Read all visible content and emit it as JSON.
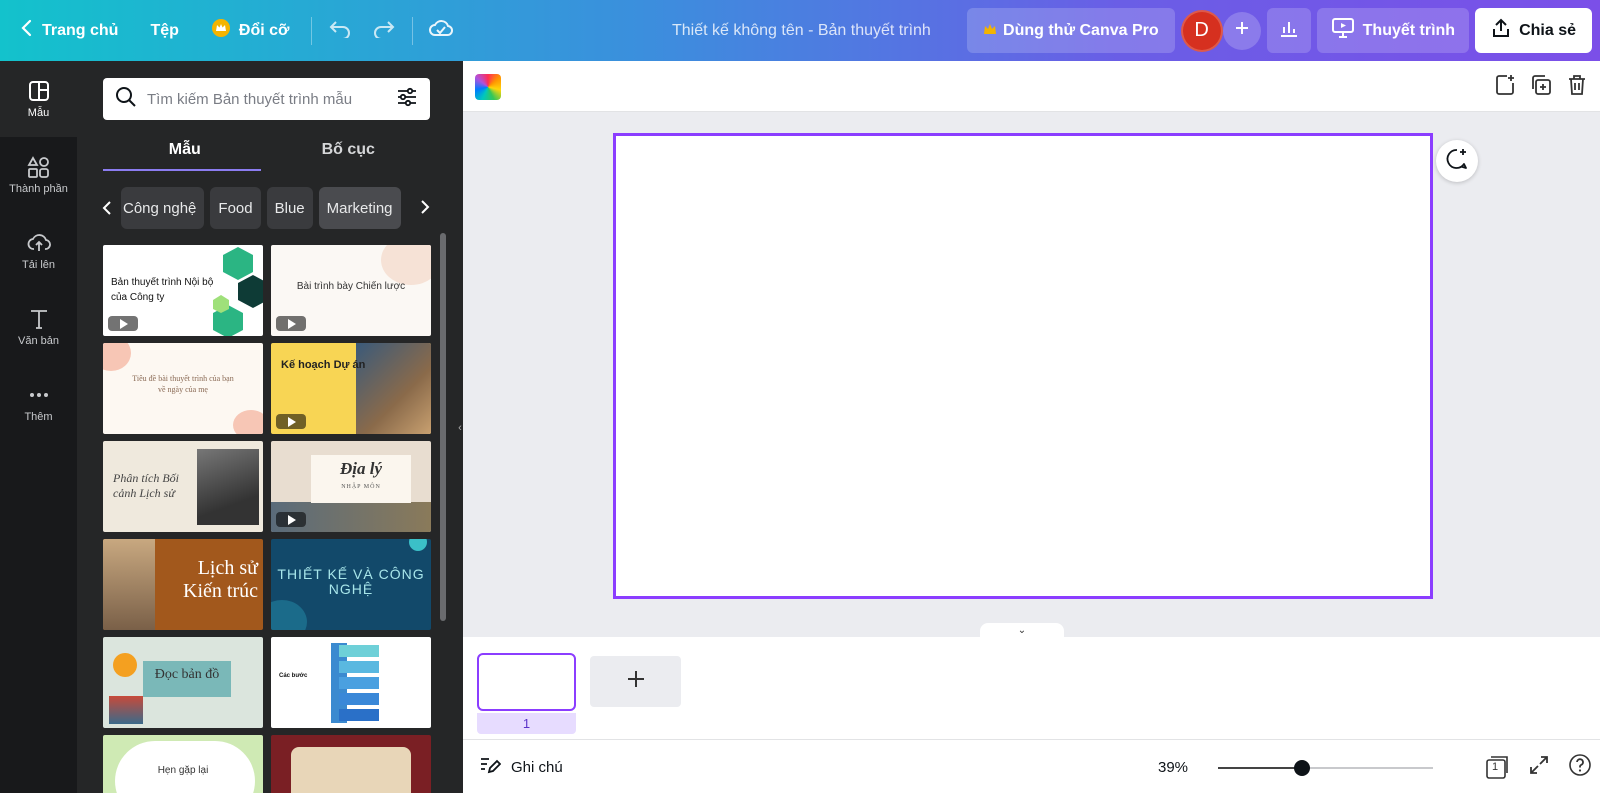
{
  "topbar": {
    "home_label": "Trang chủ",
    "file_label": "Tệp",
    "resize_label": "Đổi cỡ",
    "document_title": "Thiết kế không tên - Bản thuyết trình",
    "pro_label": "Dùng thử Canva Pro",
    "avatar_initial": "D",
    "present_label": "Thuyết trình",
    "share_label": "Chia sẻ"
  },
  "rail": {
    "items": [
      {
        "label": "Mẫu",
        "icon": "template-icon"
      },
      {
        "label": "Thành phần",
        "icon": "elements-icon"
      },
      {
        "label": "Tải lên",
        "icon": "upload-cloud-icon"
      },
      {
        "label": "Văn bản",
        "icon": "text-icon"
      },
      {
        "label": "Thêm",
        "icon": "more-dots-icon"
      }
    ]
  },
  "panel": {
    "search_placeholder": "Tìm kiếm Bản thuyết trình mẫu",
    "tabs": [
      "Mẫu",
      "Bố cục"
    ],
    "chips": [
      "Công nghệ",
      "Food",
      "Blue",
      "Marketing"
    ],
    "templates": [
      {
        "title": "Bản thuyết trình Nội bộ của Công ty",
        "video": true
      },
      {
        "title": "Bài trình bày Chiến lược",
        "video": true
      },
      {
        "title": "Tiêu đề bài thuyết trình của bạn về ngày của mẹ",
        "video": false
      },
      {
        "title": "Kế hoạch Dự án",
        "video": true
      },
      {
        "title": "Phân tích Bối cảnh Lịch sử",
        "video": false
      },
      {
        "title": "Địa lý",
        "subtitle": "NHẬP MÔN",
        "video": true
      },
      {
        "title": "Lịch sử Kiến trúc",
        "video": false
      },
      {
        "title": "THIẾT KẾ VÀ CÔNG NGHỆ",
        "video": false
      },
      {
        "title": "Đọc bản đồ",
        "video": false
      },
      {
        "title": "Các bước",
        "video": false
      },
      {
        "title": "Hẹn gặp lại",
        "video": false
      },
      {
        "title": "",
        "video": false
      }
    ]
  },
  "editor": {
    "page_number": "1",
    "notes_label": "Ghi chú",
    "zoom_label": "39%",
    "zoom_fraction": 0.39,
    "page_count_badge": "1"
  },
  "colors": {
    "accent": "#8b3dff",
    "avatar": "#d6301f",
    "panel": "#252627",
    "rail": "#18191b"
  }
}
